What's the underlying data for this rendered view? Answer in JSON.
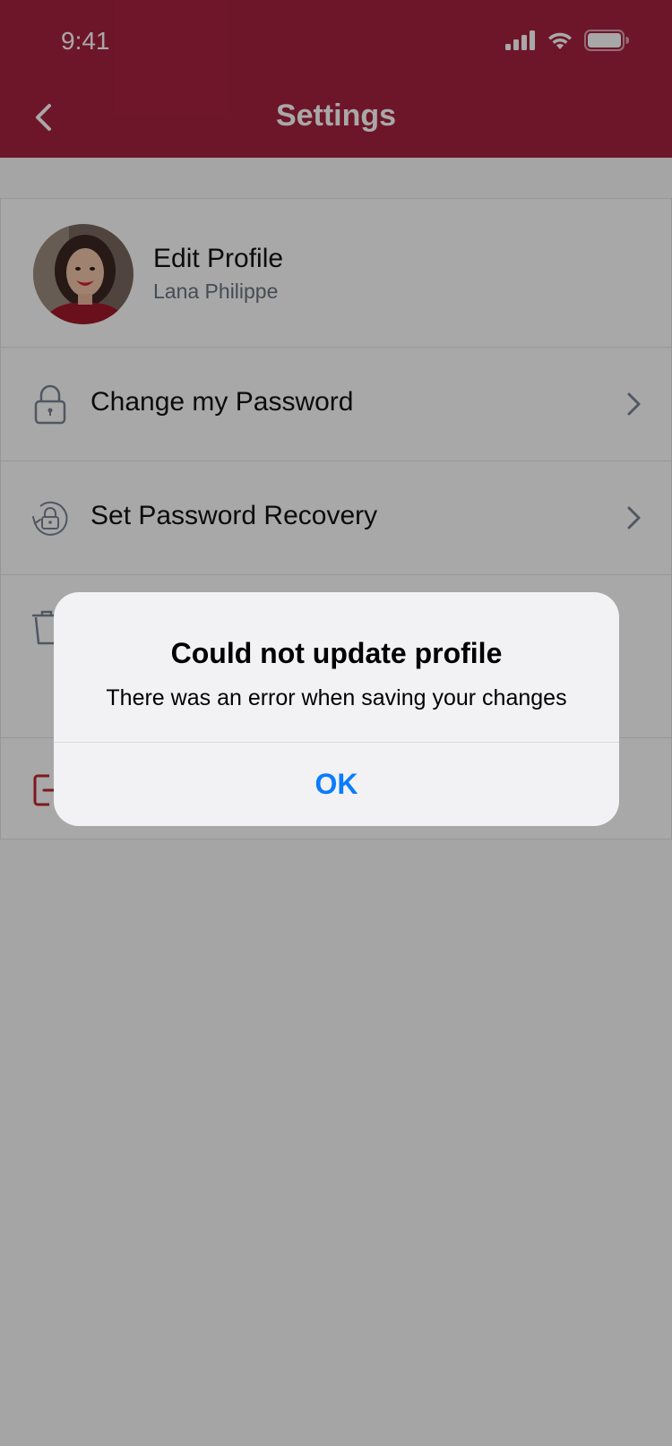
{
  "status_bar": {
    "time": "9:41"
  },
  "nav": {
    "title": "Settings"
  },
  "profile": {
    "title": "Edit Profile",
    "name": "Lana Philippe"
  },
  "menu": {
    "change_password": "Change my Password",
    "password_recovery": "Set Password Recovery"
  },
  "alert": {
    "title": "Could not update profile",
    "message": "There was an error when saving your changes",
    "ok_label": "OK"
  },
  "colors": {
    "header": "#a8223f",
    "alert_button": "#0a7cff",
    "logout_icon": "#c1272d"
  }
}
